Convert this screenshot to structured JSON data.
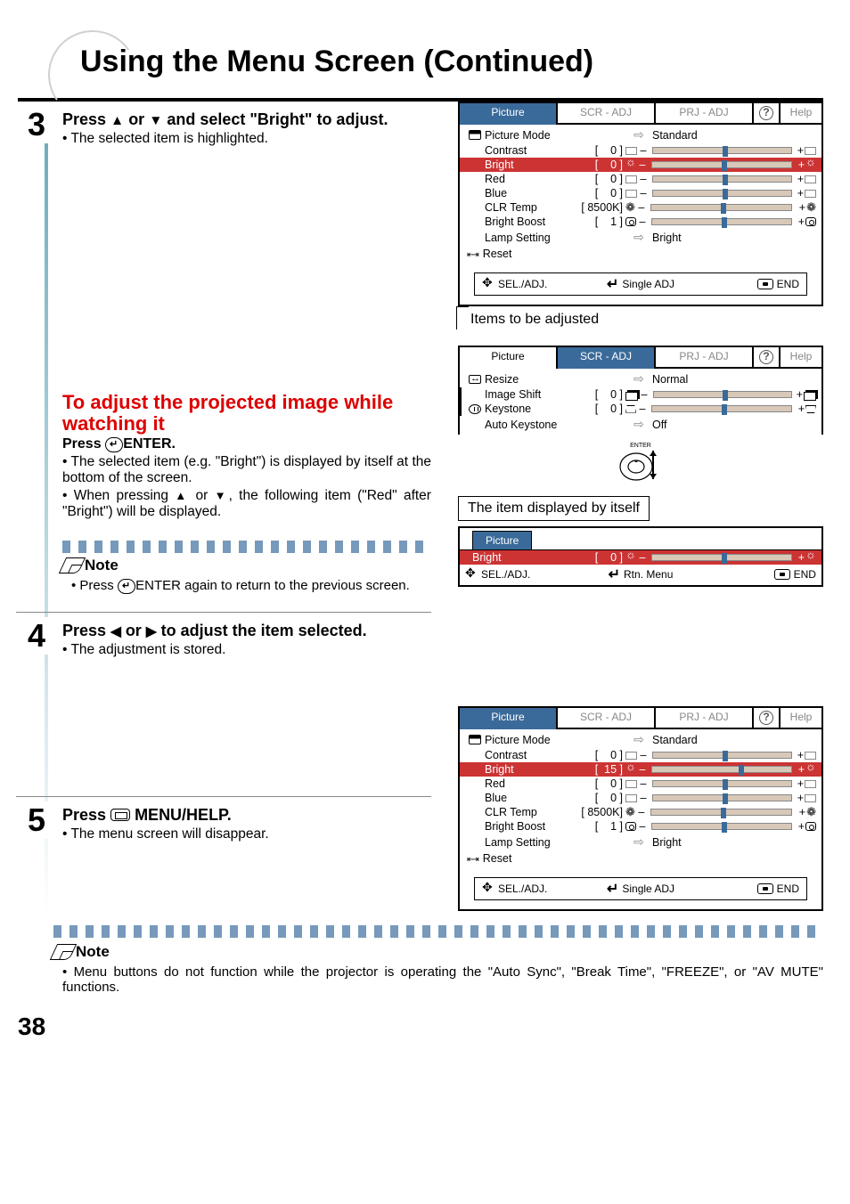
{
  "header": {
    "title": "Using the Menu Screen (Continued)"
  },
  "step3": {
    "num": "3",
    "title_a": "Press ",
    "title_b": " or ",
    "title_c": " and select \"Bright\" to adjust.",
    "bullet": "• The selected item is highlighted."
  },
  "adjust": {
    "heading": "To adjust the projected image while watching it",
    "press": "Press ",
    "enter": "ENTER.",
    "b1": "• The selected item (e.g. \"Bright\") is displayed by itself at the bottom of the screen.",
    "b2a": "• When pressing ",
    "b2b": " or ",
    "b2c": ", the following item (\"Red\" after \"Bright\") will be displayed."
  },
  "note1": {
    "label": "Note",
    "body_a": "• Press ",
    "body_b": "ENTER again to return to the previous screen."
  },
  "step4": {
    "num": "4",
    "title_a": "Press ",
    "title_b": " or ",
    "title_c": " to adjust the item selected.",
    "bullet": "• The adjustment is stored."
  },
  "step5": {
    "num": "5",
    "title_a": "Press ",
    "title_b": "MENU/HELP.",
    "bullet": "• The menu screen will disappear."
  },
  "note2": {
    "label": "Note",
    "body": "• Menu buttons do not function while the projector is operating the \"Auto Sync\", \"Break Time\", \"FREEZE\", or \"AV MUTE\" functions."
  },
  "pageNum": "38",
  "osd": {
    "tabs": {
      "picture": "Picture",
      "scr": "SCR - ADJ",
      "prj": "PRJ - ADJ",
      "help": "Help"
    },
    "picMode": {
      "label": "Picture Mode",
      "value": "Standard"
    },
    "rows": {
      "contrast": {
        "label": "Contrast",
        "val": "0"
      },
      "bright": {
        "label": "Bright",
        "val": "0"
      },
      "bright15": {
        "label": "Bright",
        "val": "15"
      },
      "red": {
        "label": "Red",
        "val": "0"
      },
      "blue": {
        "label": "Blue",
        "val": "0"
      },
      "clr": {
        "label": "CLR Temp",
        "val": "8500K"
      },
      "boost": {
        "label": "Bright Boost",
        "val": "1"
      }
    },
    "lamp": {
      "label": "Lamp Setting",
      "value": "Bright"
    },
    "reset": "Reset",
    "legend": {
      "sel": "SEL./ADJ.",
      "single": "Single ADJ",
      "rtn": "Rtn. Menu",
      "end": "END"
    }
  },
  "caption1": "Items to be adjusted",
  "osd2": {
    "resize": {
      "label": "Resize",
      "value": "Normal"
    },
    "shift": {
      "label": "Image Shift",
      "val": "0"
    },
    "keystone": {
      "label": "Keystone",
      "val": "0"
    },
    "auto": {
      "label": "Auto Keystone",
      "value": "Off"
    }
  },
  "enterLabel": "ENTER",
  "caption2": "The item displayed by itself",
  "singleTab": "Picture"
}
